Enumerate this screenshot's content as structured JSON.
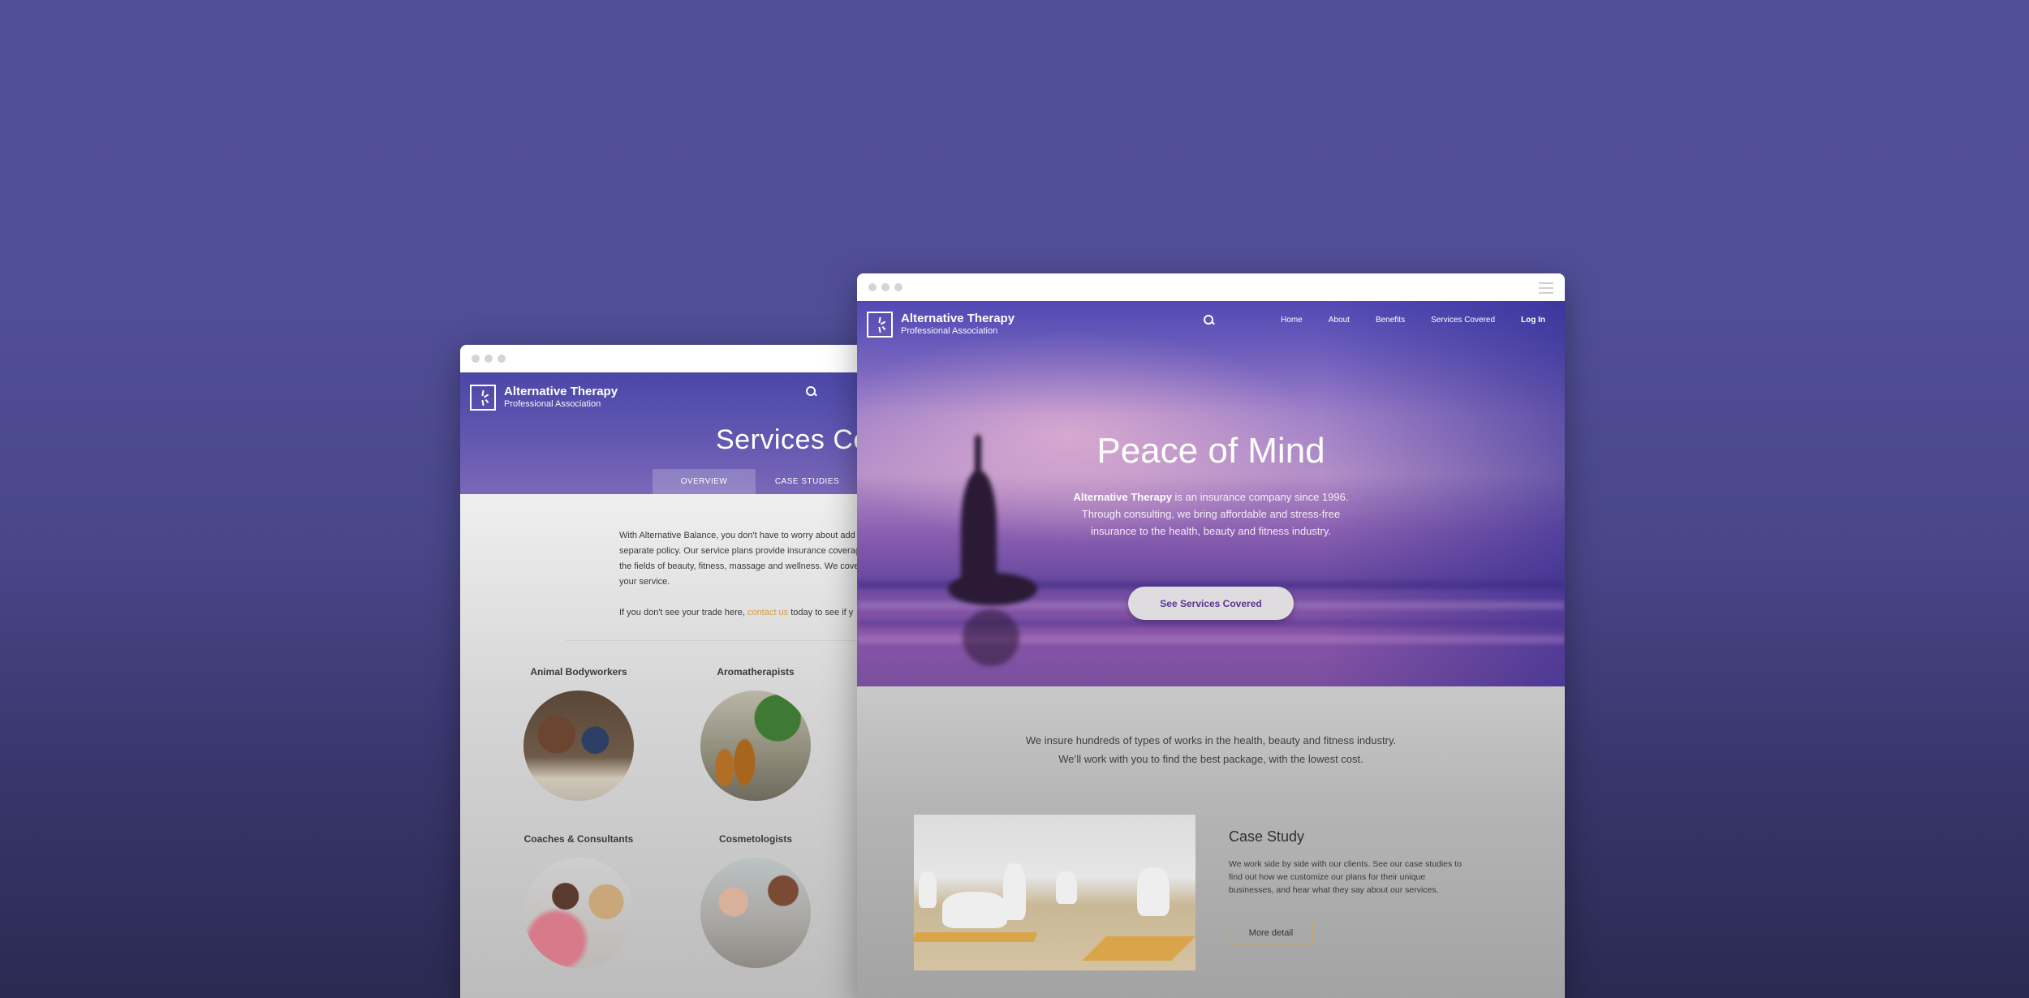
{
  "brand": {
    "title": "Alternative Therapy",
    "subtitle": "Professional Association"
  },
  "left_window": {
    "page_title": "Services Covered",
    "tabs": [
      {
        "label": "OVERVIEW",
        "active": true
      },
      {
        "label": "CASE STUDIES",
        "active": false
      }
    ],
    "intro_lines": [
      "With Alternative Balance, you don't have to worry about add",
      "separate policy. Our service plans provide insurance coverag",
      "the fields of beauty, fitness, massage and wellness. We cove",
      "your service."
    ],
    "contact_prefix": "If you don't see your trade here, ",
    "contact_link": "contact us",
    "contact_suffix": " today to see if y",
    "services": [
      {
        "label": "Animal Bodyworkers",
        "image": "horse-bodywork-photo"
      },
      {
        "label": "Aromatherapists",
        "image": "essential-oils-photo"
      },
      {
        "label": "Coaches & Consultants",
        "image": "coaching-photo"
      },
      {
        "label": "Cosmetologists",
        "image": "makeup-photo"
      }
    ]
  },
  "right_window": {
    "nav": [
      "Home",
      "About",
      "Benefits",
      "Services Covered"
    ],
    "login": "Log In",
    "hero_title": "Peace of Mind",
    "hero_brand": "Alternative Therapy",
    "hero_line1_rest": " is an insurance company since 1996.",
    "hero_line2": "Through consulting, we bring affordable and stress-free",
    "hero_line3": "insurance to the health, beauty and fitness industry.",
    "cta": "See Services Covered",
    "tagline1": "We insure hundreds of types of works in the health, beauty and fitness industry.",
    "tagline2": "We’ll work with you to find the best package, with the lowest cost.",
    "case_title": "Case Study",
    "case_text": "We work side by side with our clients. See our case studies to find out how we customize our plans for their unique businesses, and hear what they say about our services.",
    "more_button": "More detail"
  },
  "colors": {
    "accent_purple": "#5a3592",
    "link_orange": "#d99c3c",
    "button_border": "#c9a565"
  }
}
